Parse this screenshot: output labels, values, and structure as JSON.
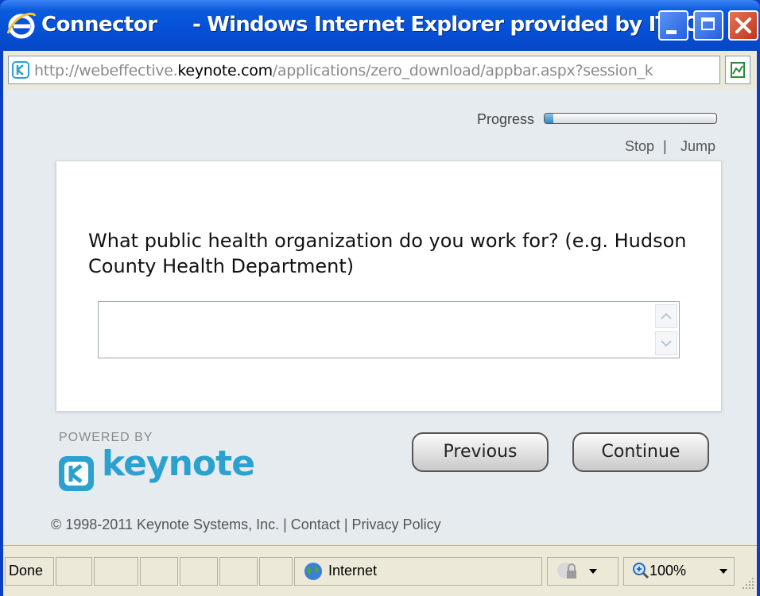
{
  "window": {
    "app_name": "Connector",
    "title_rest": "- Windows Internet Explorer provided by ITSO"
  },
  "address": {
    "url_prefix": "http://webeffective.",
    "url_domain": "keynote.com",
    "url_suffix": "/applications/zero_download/appbar.aspx?session_k"
  },
  "survey": {
    "progress_label": "Progress",
    "progress_fraction": 0.05,
    "stop_label": "Stop",
    "separator": "|",
    "jump_label": "Jump",
    "question": "What public health organization do you work for? (e.g. Hudson County Health Department)",
    "answer_value": "",
    "previous_label": "Previous",
    "continue_label": "Continue",
    "powered_by": "POWERED BY",
    "brand_name": "keynote",
    "copyright": "© 1998-2011 Keynote Systems, Inc.",
    "contact_label": "Contact",
    "privacy_label": "Privacy Policy"
  },
  "statusbar": {
    "status_text": "Done",
    "zone_label": "Internet",
    "zoom_label": "100%"
  },
  "colors": {
    "title_blue": "#0550d8",
    "brand_teal": "#2aa1cf",
    "progress_fill": "#2a86c6"
  }
}
